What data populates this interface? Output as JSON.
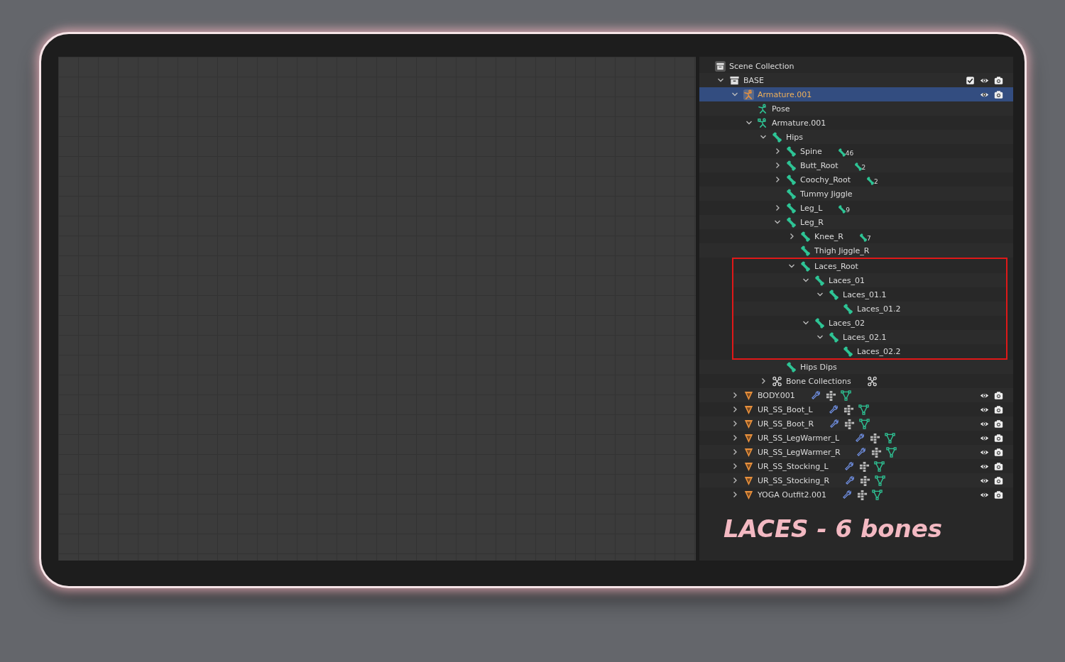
{
  "outliner": {
    "tree": [
      {
        "label": "Scene Collection",
        "kind": "scene",
        "selected": false,
        "children": [
          {
            "label": "BASE",
            "kind": "collection",
            "expanded": true,
            "checked": true,
            "selected": false,
            "children": [
              {
                "label": "Armature.001",
                "kind": "armature-object",
                "expanded": true,
                "selected": true,
                "children": [
                  {
                    "label": "Pose",
                    "kind": "pose",
                    "selected": false
                  },
                  {
                    "label": "Armature.001",
                    "kind": "armature-data",
                    "expanded": true,
                    "selected": false,
                    "children": [
                      {
                        "label": "Hips",
                        "kind": "bone",
                        "expanded": true,
                        "selected": false,
                        "children": [
                          {
                            "label": "Spine",
                            "kind": "bone",
                            "expanded": false,
                            "count": "46",
                            "selected": false
                          },
                          {
                            "label": "Butt_Root",
                            "kind": "bone",
                            "expanded": false,
                            "count": "2",
                            "selected": false
                          },
                          {
                            "label": "Coochy_Root",
                            "kind": "bone",
                            "expanded": false,
                            "count": "2",
                            "selected": false
                          },
                          {
                            "label": "Tummy Jiggle",
                            "kind": "bone",
                            "selected": false
                          },
                          {
                            "label": "Leg_L",
                            "kind": "bone",
                            "expanded": false,
                            "count": "9",
                            "selected": false
                          },
                          {
                            "label": "Leg_R",
                            "kind": "bone",
                            "expanded": true,
                            "selected": false,
                            "children": [
                              {
                                "label": "Knee_R",
                                "kind": "bone",
                                "expanded": false,
                                "count": "7",
                                "selected": false
                              },
                              {
                                "label": "Thigh Jiggle_R",
                                "kind": "bone",
                                "selected": false
                              },
                              {
                                "label": "Laces_Root",
                                "kind": "bone",
                                "expanded": true,
                                "highlighted": true,
                                "selected": false,
                                "children": [
                                  {
                                    "label": "Laces_01",
                                    "kind": "bone",
                                    "expanded": true,
                                    "selected": false,
                                    "children": [
                                      {
                                        "label": "Laces_01.1",
                                        "kind": "bone",
                                        "expanded": true,
                                        "selected": false,
                                        "children": [
                                          {
                                            "label": "Laces_01.2",
                                            "kind": "bone",
                                            "selected": false
                                          }
                                        ]
                                      }
                                    ]
                                  },
                                  {
                                    "label": "Laces_02",
                                    "kind": "bone",
                                    "expanded": true,
                                    "selected": false,
                                    "children": [
                                      {
                                        "label": "Laces_02.1",
                                        "kind": "bone",
                                        "expanded": true,
                                        "selected": false,
                                        "children": [
                                          {
                                            "label": "Laces_02.2",
                                            "kind": "bone",
                                            "selected": false
                                          }
                                        ]
                                      }
                                    ]
                                  }
                                ]
                              }
                            ]
                          },
                          {
                            "label": "Hips Dips",
                            "kind": "bone",
                            "selected": false
                          }
                        ]
                      },
                      {
                        "label": "Bone Collections",
                        "kind": "bone-collections",
                        "expanded": false,
                        "selected": false
                      }
                    ]
                  }
                ]
              },
              {
                "label": "BODY.001",
                "kind": "mesh",
                "expanded": false,
                "selected": false
              },
              {
                "label": "UR_SS_Boot_L",
                "kind": "mesh",
                "expanded": false,
                "selected": false
              },
              {
                "label": "UR_SS_Boot_R",
                "kind": "mesh",
                "expanded": false,
                "selected": false
              },
              {
                "label": "UR_SS_LegWarmer_L",
                "kind": "mesh",
                "expanded": false,
                "selected": false
              },
              {
                "label": "UR_SS_LegWarmer_R",
                "kind": "mesh",
                "expanded": false,
                "selected": false
              },
              {
                "label": "UR_SS_Stocking_L",
                "kind": "mesh",
                "expanded": false,
                "selected": false
              },
              {
                "label": "UR_SS_Stocking_R",
                "kind": "mesh",
                "expanded": false,
                "selected": false
              },
              {
                "label": "YOGA Outfit2.001",
                "kind": "mesh",
                "expanded": false,
                "selected": false
              }
            ]
          }
        ]
      }
    ]
  },
  "caption": "LACES - 6 bones"
}
